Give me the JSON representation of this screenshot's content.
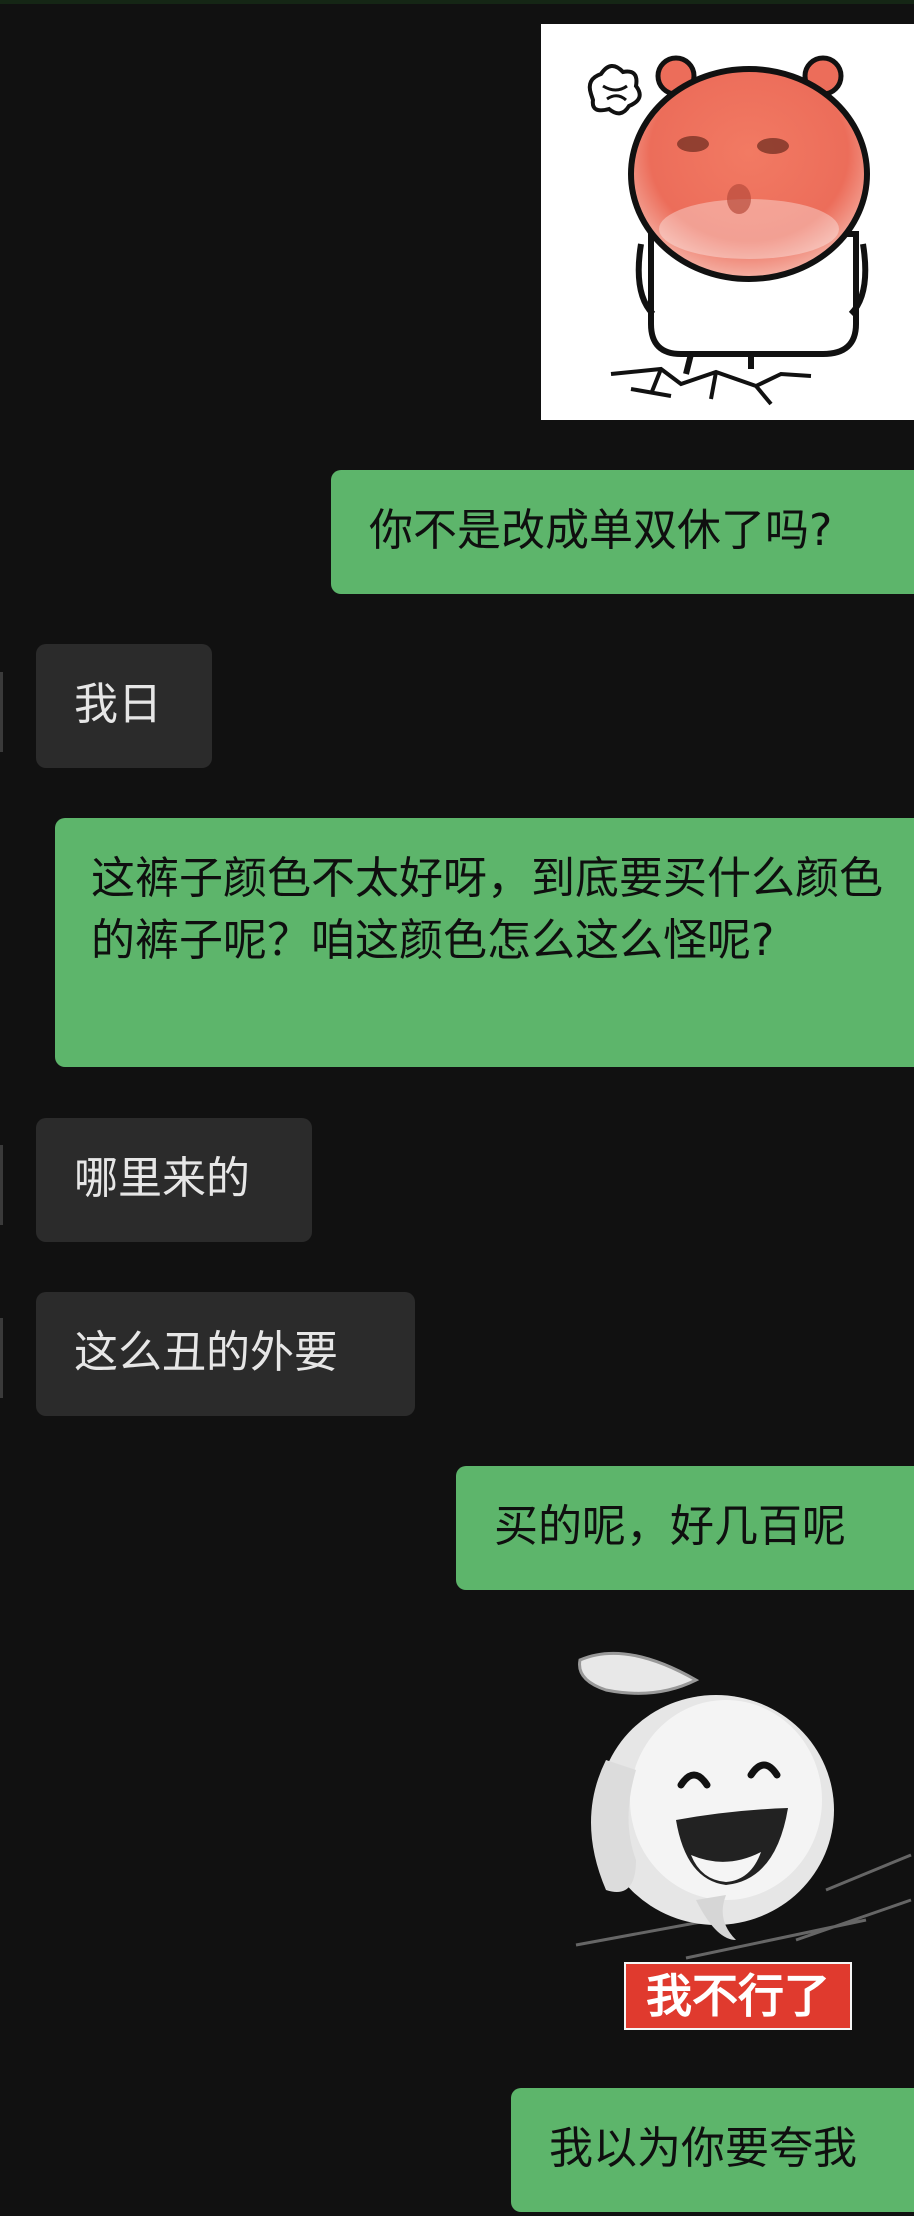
{
  "messages": [
    {
      "side": "outgoing",
      "type": "sticker",
      "name": "angry-hamster-sticker"
    },
    {
      "side": "outgoing",
      "type": "text",
      "text": "你不是改成单双休了吗?"
    },
    {
      "side": "incoming",
      "type": "text",
      "text": "我日"
    },
    {
      "side": "outgoing",
      "type": "text",
      "text": "这裤子颜色不太好呀，到底要买什么颜色的裤子呢？咱这颜色怎么这么怪呢?"
    },
    {
      "side": "incoming",
      "type": "text",
      "text": "哪里来的"
    },
    {
      "side": "incoming",
      "type": "text",
      "text": "这么丑的外要"
    },
    {
      "side": "outgoing",
      "type": "text",
      "text": "买的呢，好几百呢"
    },
    {
      "side": "outgoing",
      "type": "sticker",
      "name": "laughing-bunny-sticker",
      "caption": "我不行了"
    },
    {
      "side": "outgoing",
      "type": "text",
      "text": "我以为你要夸我"
    }
  ],
  "colors": {
    "background": "#111111",
    "outgoing_bubble": "#5db56b",
    "incoming_bubble": "#2b2b2b",
    "sticker_caption_bg": "#e03a2e"
  }
}
